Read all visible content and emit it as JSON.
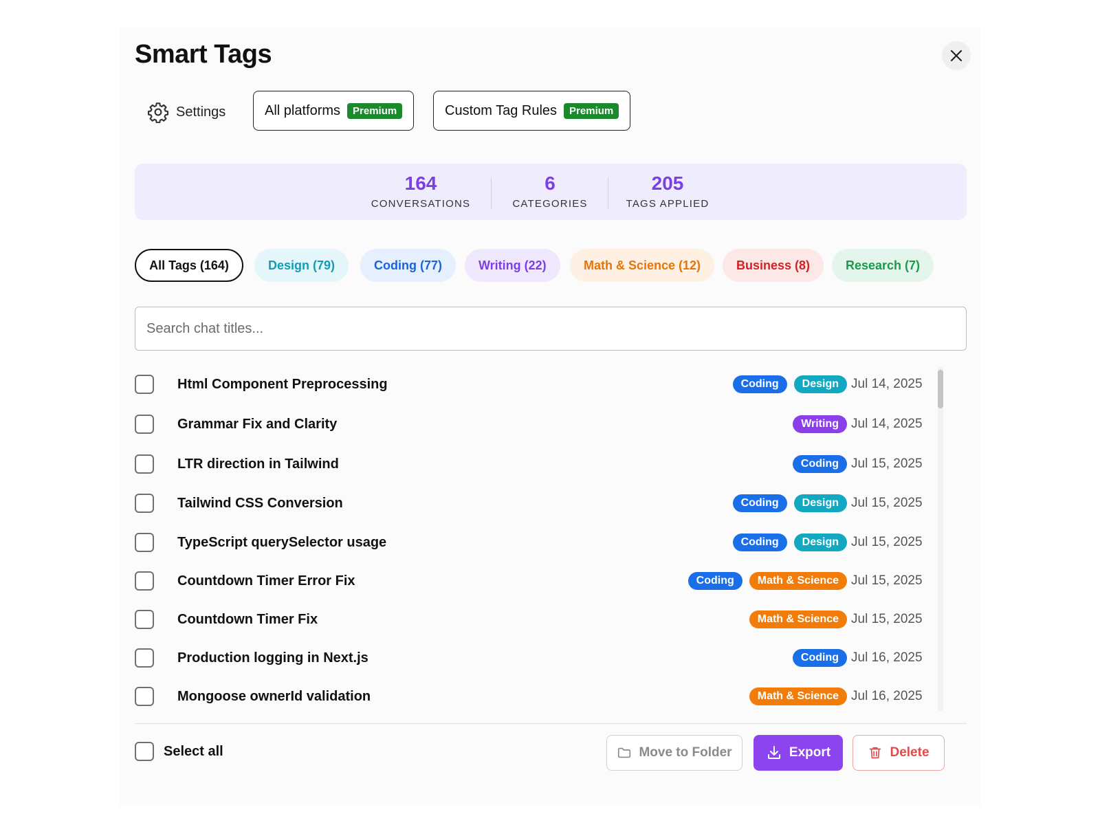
{
  "dialog": {
    "title": "Smart Tags",
    "close_icon": "close-icon"
  },
  "toolbar": {
    "settings_label": "Settings",
    "settings_icon": "gear-icon",
    "all_platforms_label": "All platforms",
    "custom_rules_label": "Custom Tag Rules",
    "premium_badge": "Premium"
  },
  "stats": [
    {
      "value": "164",
      "label": "CONVERSATIONS"
    },
    {
      "value": "6",
      "label": "CATEGORIES"
    },
    {
      "value": "205",
      "label": "TAGS APPLIED"
    }
  ],
  "filters": [
    {
      "label": "All Tags (164)",
      "active": true
    },
    {
      "label": "Design (79)"
    },
    {
      "label": "Coding (77)"
    },
    {
      "label": "Writing (22)"
    },
    {
      "label": "Math & Science (12)"
    },
    {
      "label": "Business (8)"
    },
    {
      "label": "Research (7)"
    }
  ],
  "search": {
    "placeholder": "Search chat titles..."
  },
  "tag_colors": {
    "Coding": "#1a6fe8",
    "Design": "#12a8c2",
    "Writing": "#8a3fe8",
    "Math & Science": "#f27c0a"
  },
  "conversations": [
    {
      "title": "Html Component Preprocessing",
      "tags": [
        "Coding",
        "Design"
      ],
      "date": "Jul 14, 2025"
    },
    {
      "title": "Grammar Fix and Clarity",
      "tags": [
        "Writing"
      ],
      "date": "Jul 14, 2025"
    },
    {
      "title": "LTR direction in Tailwind",
      "tags": [
        "Coding"
      ],
      "date": "Jul 15, 2025"
    },
    {
      "title": "Tailwind CSS Conversion",
      "tags": [
        "Coding",
        "Design"
      ],
      "date": "Jul 15, 2025"
    },
    {
      "title": "TypeScript querySelector usage",
      "tags": [
        "Coding",
        "Design"
      ],
      "date": "Jul 15, 2025"
    },
    {
      "title": "Countdown Timer Error Fix",
      "tags": [
        "Coding",
        "Math & Science"
      ],
      "date": "Jul 15, 2025"
    },
    {
      "title": "Countdown Timer Fix",
      "tags": [
        "Math & Science"
      ],
      "date": "Jul 15, 2025"
    },
    {
      "title": "Production logging in Next.js",
      "tags": [
        "Coding"
      ],
      "date": "Jul 16, 2025"
    },
    {
      "title": "Mongoose ownerId validation",
      "tags": [
        "Math & Science"
      ],
      "date": "Jul 16, 2025"
    }
  ],
  "footer": {
    "select_all_label": "Select all",
    "move_label": "Move to Folder",
    "move_icon": "folder-icon",
    "export_label": "Export",
    "export_icon": "download-icon",
    "delete_label": "Delete",
    "delete_icon": "trash-icon"
  }
}
